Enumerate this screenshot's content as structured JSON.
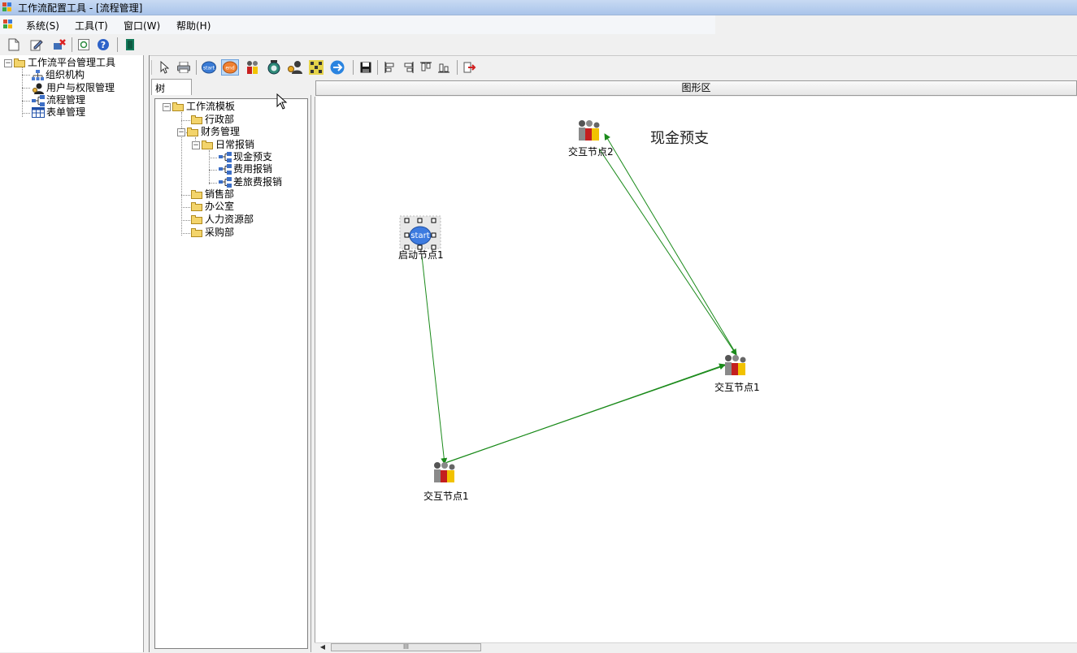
{
  "window": {
    "title": "工作流配置工具 - [流程管理]"
  },
  "menu": {
    "items": [
      "系统(S)",
      "工具(T)",
      "窗口(W)",
      "帮助(H)"
    ]
  },
  "leftnav": {
    "root": "工作流平台管理工具",
    "items": [
      "组织机构",
      "用户与权限管理",
      "流程管理",
      "表单管理"
    ]
  },
  "tree_tab": {
    "label": "树"
  },
  "tree": {
    "root": "工作流模板",
    "dept_admin": "行政部",
    "dept_finance": "财务管理",
    "daily": "日常报销",
    "processes": [
      "现金预支",
      "费用报销",
      "差旅费报销"
    ],
    "others": [
      "销售部",
      "办公室",
      "人力资源部",
      "采购部"
    ]
  },
  "graph": {
    "header": "图形区",
    "process_name": "现金预支",
    "start_icon_text": "start",
    "end_icon_text": "end",
    "nodes": {
      "start": "启动节点1",
      "interact_bottom": "交互节点1",
      "interact_right": "交互节点1",
      "interact_top": "交互节点2"
    },
    "connector_color": "#1a8a1a"
  },
  "scroll": {
    "thumb_grip": "III",
    "left_arrow": "◀"
  },
  "icons": {
    "app": "app-window-icon",
    "toolbar1": [
      "new-document-icon",
      "edit-icon",
      "delete-icon",
      "refresh-icon",
      "help-icon",
      "exit-icon"
    ],
    "toolbar2": [
      "pointer-icon",
      "print-icon",
      "start-node-icon",
      "end-node-icon",
      "interactive-node-icon",
      "auto-node-icon",
      "sub-process-icon",
      "route-node-icon",
      "connector-icon",
      "save-icon",
      "align-left-icon",
      "align-right-icon",
      "align-top-icon",
      "align-bottom-icon",
      "export-icon"
    ]
  }
}
